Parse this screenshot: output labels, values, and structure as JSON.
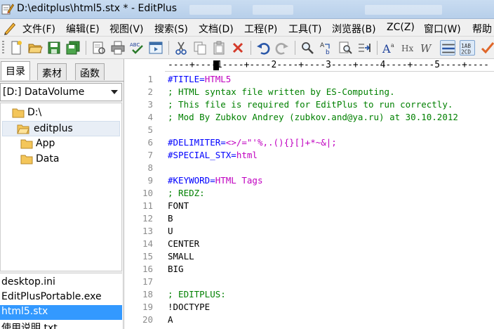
{
  "window": {
    "title": "D:\\editplus\\html5.stx * - EditPlus"
  },
  "menu": [
    "文件(F)",
    "编辑(E)",
    "视图(V)",
    "搜索(S)",
    "文档(D)",
    "工程(P)",
    "工具(T)",
    "浏览器(B)",
    "ZC(Z)",
    "窗口(W)",
    "帮助"
  ],
  "toolbar_icons": [
    "new-file-icon",
    "open-folder-icon",
    "save-icon",
    "save-all-icon",
    "print-preview-icon",
    "print-icon",
    "spell-check-icon",
    "browser-preview-icon",
    "cut-icon",
    "copy-icon",
    "paste-icon",
    "delete-icon",
    "undo-icon",
    "redo-icon",
    "find-icon",
    "replace-icon",
    "find-in-files-icon",
    "goto-line-icon",
    "font-size-icon",
    "hex-viewer-icon",
    "word-wrap-icon",
    "ruler-icon",
    "line-number-icon",
    "cliptext-icon"
  ],
  "sidebar": {
    "tabs": [
      "目录",
      "素材",
      "函数"
    ],
    "active_tab": "目录",
    "drive": "[D:] DataVolume",
    "tree": [
      {
        "label": "D:\\",
        "level": 0
      },
      {
        "label": "editplus",
        "level": 1,
        "selected": true
      },
      {
        "label": "App",
        "level": 2
      },
      {
        "label": "Data",
        "level": 2
      }
    ],
    "files": [
      {
        "name": "desktop.ini"
      },
      {
        "name": "EditPlusPortable.exe"
      },
      {
        "name": "html5.stx",
        "selected": true
      },
      {
        "name": "使用说明.txt"
      }
    ]
  },
  "editor": {
    "ruler": "----+----1----+----2----+----3----+----4----+----5----+----",
    "lines": [
      {
        "n": "1",
        "parts": [
          {
            "t": "#TITLE=",
            "c": "blue"
          },
          {
            "t": "HTML5",
            "c": "mag"
          }
        ]
      },
      {
        "n": "2",
        "parts": [
          {
            "t": "; HTML syntax file written by ES-Computing.",
            "c": "green"
          }
        ]
      },
      {
        "n": "3",
        "parts": [
          {
            "t": "; This file is required for EditPlus to run correctly.",
            "c": "green"
          }
        ]
      },
      {
        "n": "4",
        "parts": [
          {
            "t": "; Mod By Zubkov Andrey (zubkov.and@ya.ru) at 30.10.2012",
            "c": "green"
          }
        ]
      },
      {
        "n": "5",
        "parts": []
      },
      {
        "n": "6",
        "parts": [
          {
            "t": "#DELIMITER=",
            "c": "blue"
          },
          {
            "t": "<>/=\"'%,.(){}[]+*~&|;",
            "c": "mag"
          }
        ]
      },
      {
        "n": "7",
        "parts": [
          {
            "t": "#SPECIAL_STX=",
            "c": "blue"
          },
          {
            "t": "html",
            "c": "mag"
          }
        ]
      },
      {
        "n": "8",
        "parts": []
      },
      {
        "n": "9",
        "parts": [
          {
            "t": "#KEYWORD=",
            "c": "blue"
          },
          {
            "t": "HTML Tags",
            "c": "mag"
          }
        ]
      },
      {
        "n": "10",
        "parts": [
          {
            "t": "; REDZ:",
            "c": "green"
          }
        ]
      },
      {
        "n": "11",
        "parts": [
          {
            "t": "FONT",
            "c": "black"
          }
        ]
      },
      {
        "n": "12",
        "parts": [
          {
            "t": "B",
            "c": "black"
          }
        ]
      },
      {
        "n": "13",
        "parts": [
          {
            "t": "U",
            "c": "black"
          }
        ]
      },
      {
        "n": "14",
        "parts": [
          {
            "t": "CENTER",
            "c": "black"
          }
        ]
      },
      {
        "n": "15",
        "parts": [
          {
            "t": "SMALL",
            "c": "black"
          }
        ]
      },
      {
        "n": "16",
        "parts": [
          {
            "t": "BIG",
            "c": "black"
          }
        ]
      },
      {
        "n": "17",
        "parts": []
      },
      {
        "n": "18",
        "parts": [
          {
            "t": "; EDITPLUS:",
            "c": "green"
          }
        ]
      },
      {
        "n": "19",
        "parts": [
          {
            "t": "!DOCTYPE",
            "c": "black"
          }
        ]
      },
      {
        "n": "20",
        "parts": [
          {
            "t": "A",
            "c": "black"
          }
        ]
      }
    ]
  }
}
